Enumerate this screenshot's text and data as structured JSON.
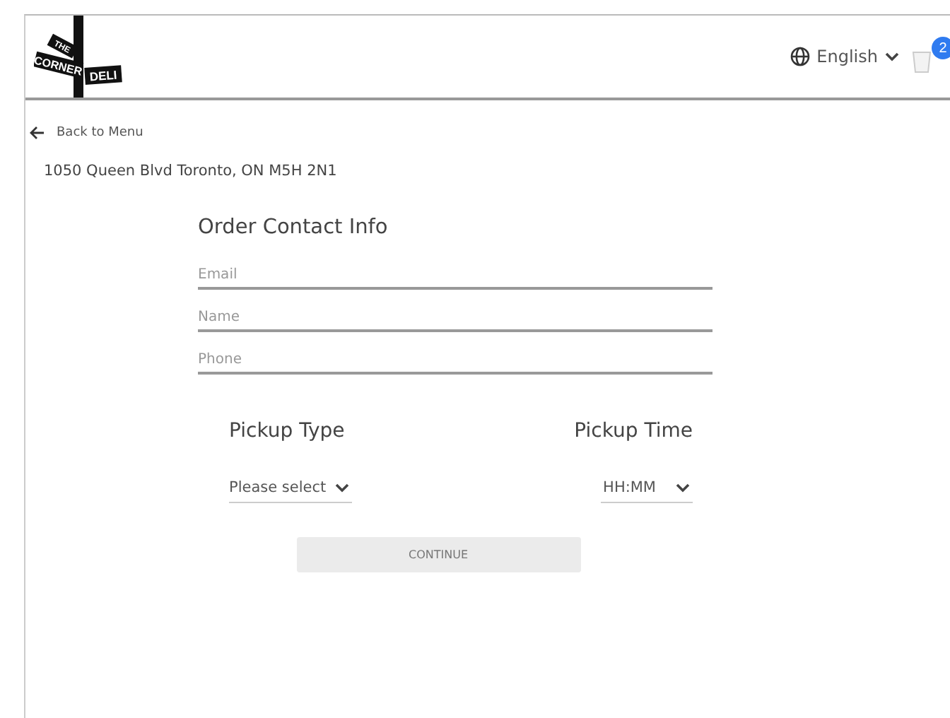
{
  "header": {
    "logo": {
      "top": "THE",
      "left": "CORNER",
      "right": "DELI"
    },
    "language": "English",
    "cart_count": "2"
  },
  "back_link": "Back to Menu",
  "address": "1050 Queen Blvd Toronto, ON M5H 2N1",
  "form": {
    "title": "Order Contact Info",
    "fields": [
      {
        "placeholder": "Email"
      },
      {
        "placeholder": "Name"
      },
      {
        "placeholder": "Phone"
      }
    ],
    "pickup": [
      {
        "heading": "Pickup Type",
        "placeholder": "Please select"
      },
      {
        "heading": "Pickup Time",
        "placeholder": "HH:MM"
      }
    ],
    "continue": {
      "label": "CONTINUE",
      "disabled": true
    }
  }
}
